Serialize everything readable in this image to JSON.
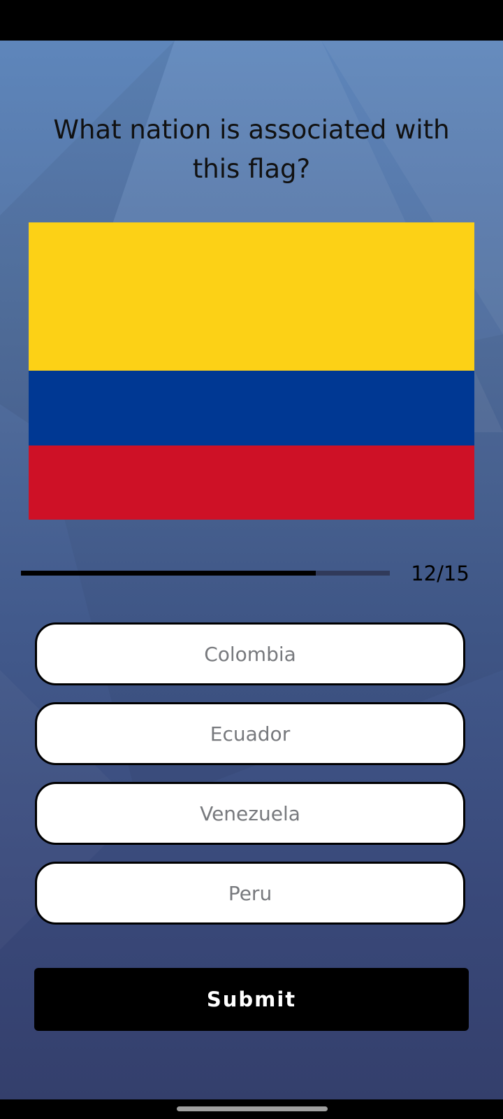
{
  "quiz": {
    "question": "What nation is associated with this flag?",
    "flag_colors": {
      "yellow": "#fcd116",
      "blue": "#003893",
      "red": "#ce1126"
    },
    "progress": {
      "current": 12,
      "total": 15,
      "label": "12/15",
      "fraction": 0.8
    },
    "options": [
      "Colombia",
      "Ecuador",
      "Venezuela",
      "Peru"
    ],
    "submit_label": "Submit"
  }
}
